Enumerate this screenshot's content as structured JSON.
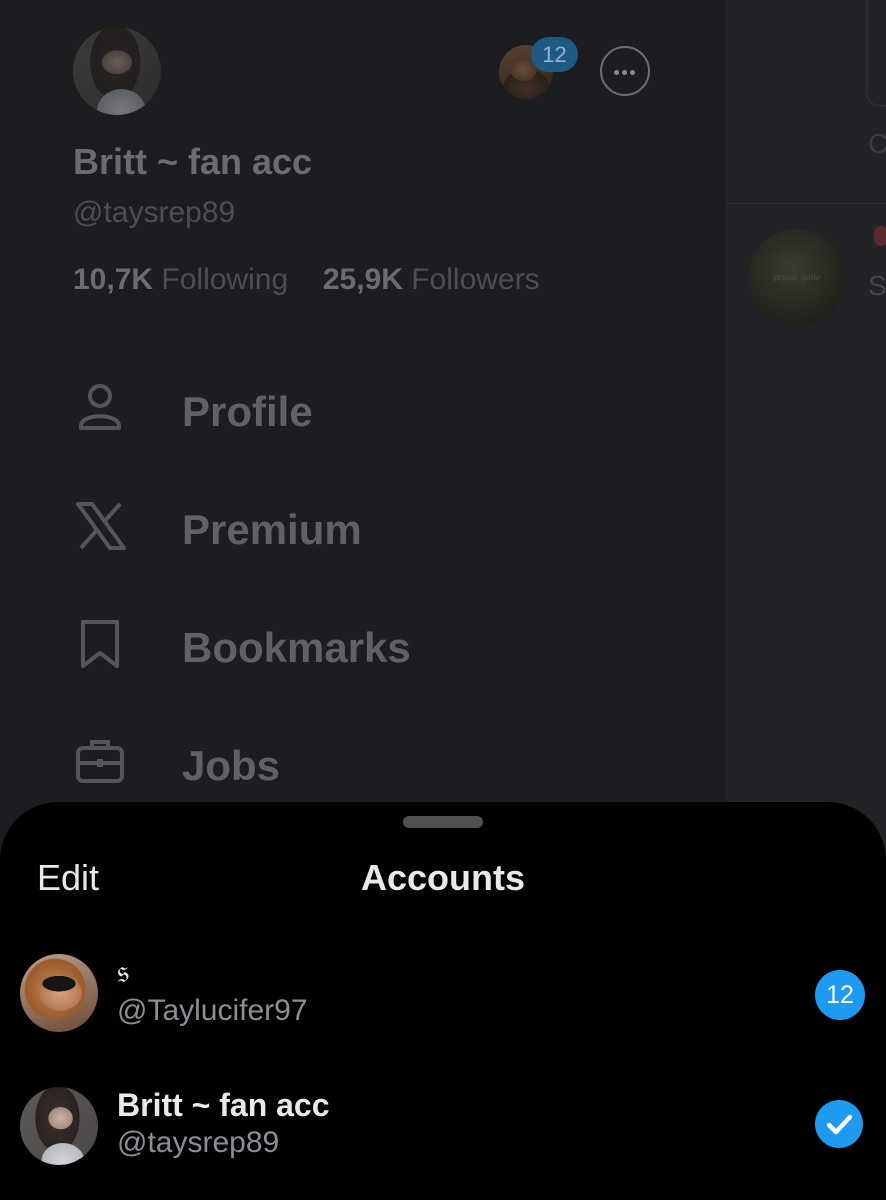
{
  "drawer": {
    "display_name": "Britt ~ fan acc",
    "handle": "@taysrep89",
    "following_count": "10,7K",
    "following_label": "Following",
    "followers_count": "25,9K",
    "followers_label": "Followers",
    "switch_badge": "12",
    "menu": [
      {
        "label": "Profile",
        "icon": "person-icon"
      },
      {
        "label": "Premium",
        "icon": "x-logo-icon"
      },
      {
        "label": "Bookmarks",
        "icon": "bookmark-icon"
      },
      {
        "label": "Jobs",
        "icon": "briefcase-icon"
      }
    ]
  },
  "sheet": {
    "edit_label": "Edit",
    "title": "Accounts",
    "accounts": [
      {
        "name": "𝔰",
        "handle": "@Taylucifer97",
        "badge": "12"
      },
      {
        "name": "Britt ~ fan acc",
        "handle": "@taysrep89",
        "selected": true
      }
    ]
  },
  "colors": {
    "accent": "#1d9bf0",
    "sheet_bg": "#000000",
    "dimmed_bg": "#1c1d20"
  }
}
